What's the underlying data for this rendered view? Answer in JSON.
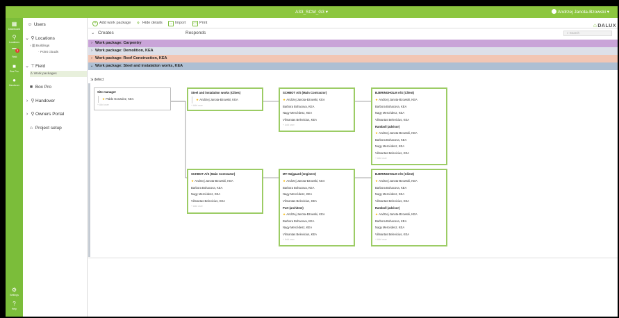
{
  "topbar": {
    "project": "A33_SCM_G3 ▾",
    "user": "Andrzej Janota-Bzowski ▾"
  },
  "rail": {
    "dashboard": "Dashboard",
    "locations": "Locations",
    "field": "Field",
    "field_badge": "3",
    "boxpro": "Box Pro",
    "handover": "Handover",
    "settings": "Settings",
    "help": "Help"
  },
  "sidenav": {
    "users": "Users",
    "locations": "Locations",
    "buildings": "Buildings",
    "point_clouds": "Point clouds",
    "field": "Field",
    "work_packages": "Work packages",
    "boxpro": "Box Pro",
    "handover": "Handover",
    "owners_portal": "Owners Portal",
    "project_setup": "Project setup"
  },
  "toolbar": {
    "add": "Add work package",
    "hide": "Hide details",
    "import": "Import",
    "print": "Print"
  },
  "columns": {
    "creates": "Creates",
    "responds": "Responds",
    "search_placeholder": "Search",
    "logo": "DALUX"
  },
  "work_packages": [
    {
      "label": "Work package: Carpentry",
      "color": "#c9a4d8"
    },
    {
      "label": "Work package: Demolition, KEA",
      "color": "#dde0e9"
    },
    {
      "label": "Work package: Roof Construction, KEA",
      "color": "#f2c6b4"
    },
    {
      "label": "Work package: Steel and instalation works, KEA",
      "color": "#aebfd3"
    }
  ],
  "defect_label": "defect",
  "cards": {
    "site_manager": {
      "title": "Site manager",
      "people": [
        "Pablo Gonzalez, KEA"
      ],
      "add": "Add user"
    },
    "steel": {
      "title": "Steel and instalation works (Cibes)",
      "people": [
        "Andrzej Janota-Bzowski, KEA"
      ],
      "add": "Add user"
    },
    "schbot1": {
      "title": "SCHBOT A/S (Main Contractor)",
      "people": [
        "Andrzej Janota-Bzowski, KEA",
        "Barbora Bohacova, KEA",
        "Nagy Mercédesz, KEA",
        "Vilmantas Belevicius, KEA"
      ],
      "add": "Add user"
    },
    "bjerring1": {
      "title": "BJERINGHOLM A/S (Client)",
      "people": [
        "Andrzej Janota-Bzowski, KEA",
        "Barbora Bohacova, KEA",
        "Nagy Mercédesz, KEA",
        "Vilmantas Belevicius, KEA"
      ],
      "sub_title": "Ramboll (advisor)",
      "sub_people": [
        "Andrzej Janota-Bzowski, KEA",
        "Barbora Bohacova, KEA",
        "Nagy Mercédesz, KEA",
        "Vilmantas Belevicius, KEA"
      ],
      "add": "Add user"
    },
    "schbot2": {
      "title": "SCHBOT A/S (Main Contractor)",
      "people": [
        "Andrzej Janota-Bzowski, KEA",
        "Barbora Bohacova, KEA",
        "Nagy Mercédesz, KEA",
        "Vilmantas Belevicius, KEA"
      ],
      "add": "Add user"
    },
    "mt": {
      "title": "MT Højgaard (engineer)",
      "people": [
        "Andrzej Janota-Bzowski, KEA",
        "Barbora Bohacova, KEA",
        "Nagy Mercédesz, KEA",
        "Vilmantas Belevicius, KEA"
      ],
      "sub_title": "PLH (architect)",
      "sub_people": [
        "Andrzej Janota-Bzowski, KEA",
        "Barbora Bohacova, KEA",
        "Nagy Mercédesz, KEA",
        "Vilmantas Belevicius, KEA"
      ],
      "add": "Add user"
    },
    "bjerring2": {
      "title": "BJERINGHOLM A/S (Client)",
      "people": [
        "Andrzej Janota-Bzowski, KEA",
        "Barbora Bohacova, KEA",
        "Nagy Mercédesz, KEA",
        "Vilmantas Belevicius, KEA"
      ],
      "sub_title": "Ramboll (advisor)",
      "sub_people": [
        "Andrzej Janota-Bzowski, KEA",
        "Barbora Bohacova, KEA",
        "Nagy Mercédesz, KEA",
        "Vilmantas Belevicius, KEA"
      ],
      "add": "Add user"
    }
  },
  "colors": {
    "accent": "#8cc63f",
    "rail": "#7bbd3a",
    "card_border": "#9ccc65"
  }
}
